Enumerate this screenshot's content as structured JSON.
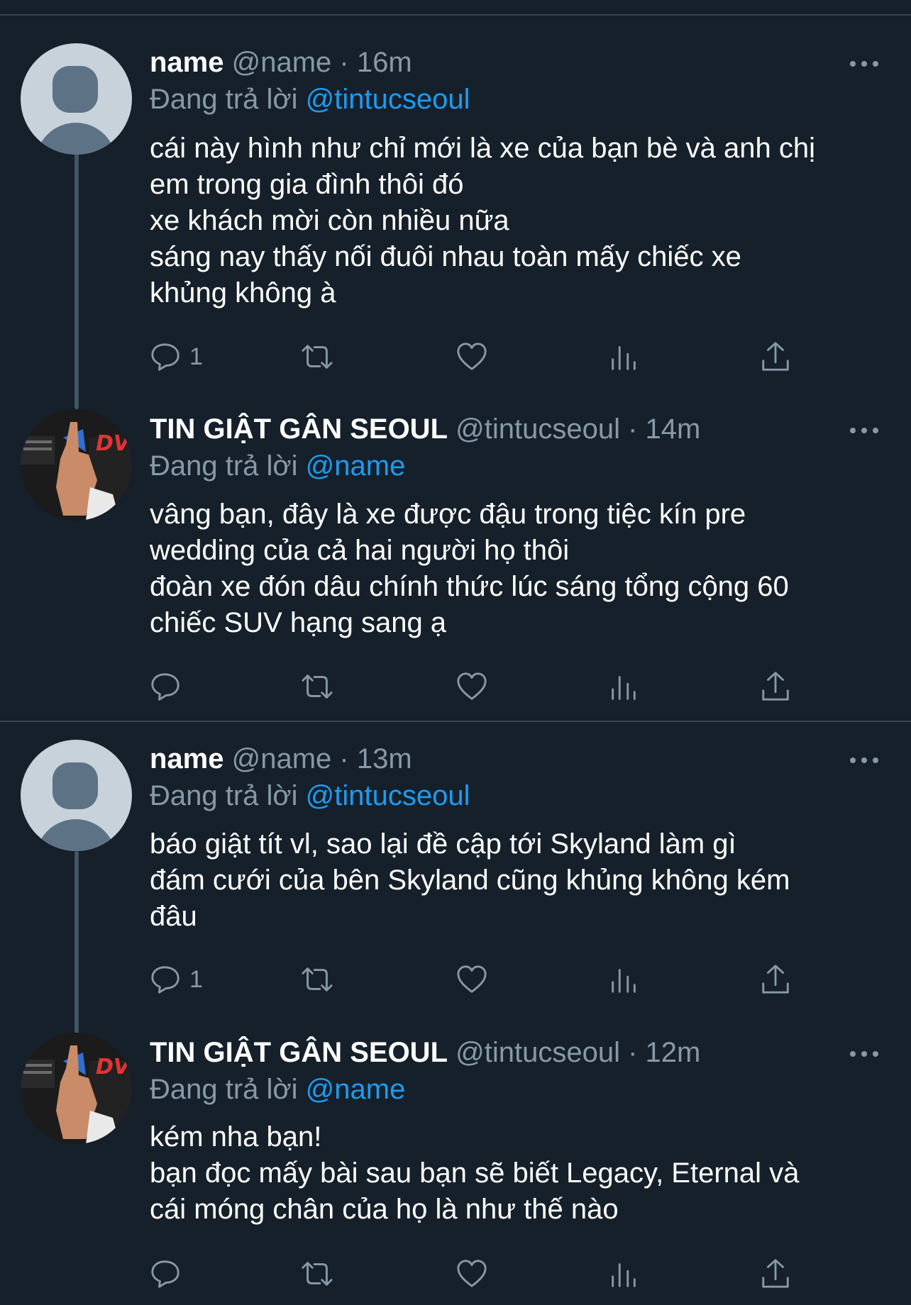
{
  "tweets": [
    {
      "display_name": "name",
      "handle_time": "@name · 16m",
      "replying_prefix": "Đang trả lời",
      "replying_to": "@tintucseoul",
      "lines": [
        "cái này hình như chỉ mới là xe của bạn bè và anh chị",
        "em trong gia đình thôi đó",
        "xe khách mời còn nhiều nữa",
        "sáng nay thấy nối đuôi nhau toàn mấy chiếc xe",
        "khủng không à"
      ],
      "reply_count": "1",
      "avatar": "default-avatar"
    },
    {
      "display_name": "TIN GIẬT GÂN SEOUL",
      "handle_time": "@tintucseoul · 14m",
      "replying_prefix": "Đang trả lời",
      "replying_to": "@name",
      "lines": [
        "vâng bạn, đây là xe được đậu trong tiệc kín pre",
        "wedding của cả hai người họ thôi",
        "đoàn xe đón dâu chính thức lúc sáng tổng cộng 60",
        "chiếc SUV hạng sang ạ"
      ],
      "reply_count": "",
      "avatar": "photo-avatar"
    },
    {
      "display_name": "name",
      "handle_time": "@name · 13m",
      "replying_prefix": "Đang trả lời",
      "replying_to": "@tintucseoul",
      "lines": [
        "báo giật tít vl, sao lại đề cập tới Skyland làm gì",
        "đám cưới của bên Skyland cũng khủng không kém",
        "đâu"
      ],
      "reply_count": "1",
      "avatar": "default-avatar"
    },
    {
      "display_name": "TIN GIẬT GÂN SEOUL",
      "handle_time": "@tintucseoul · 12m",
      "replying_prefix": "Đang trả lời",
      "replying_to": "@name",
      "lines": [
        "kém nha bạn!",
        "bạn đọc mấy bài sau bạn sẽ biết Legacy, Eternal và",
        "cái móng chân của họ là như thế nào"
      ],
      "reply_count": "",
      "avatar": "photo-avatar"
    }
  ],
  "icons": {
    "reply": "reply-icon",
    "retweet": "retweet-icon",
    "like": "heart-icon",
    "views": "views-icon",
    "share": "share-icon",
    "more": "more-icon"
  },
  "colors": {
    "background": "#15202b",
    "secondary_text": "#8899a6",
    "link": "#1d9bf0",
    "divider": "#38444d"
  },
  "photo_avatar_text": "DV"
}
